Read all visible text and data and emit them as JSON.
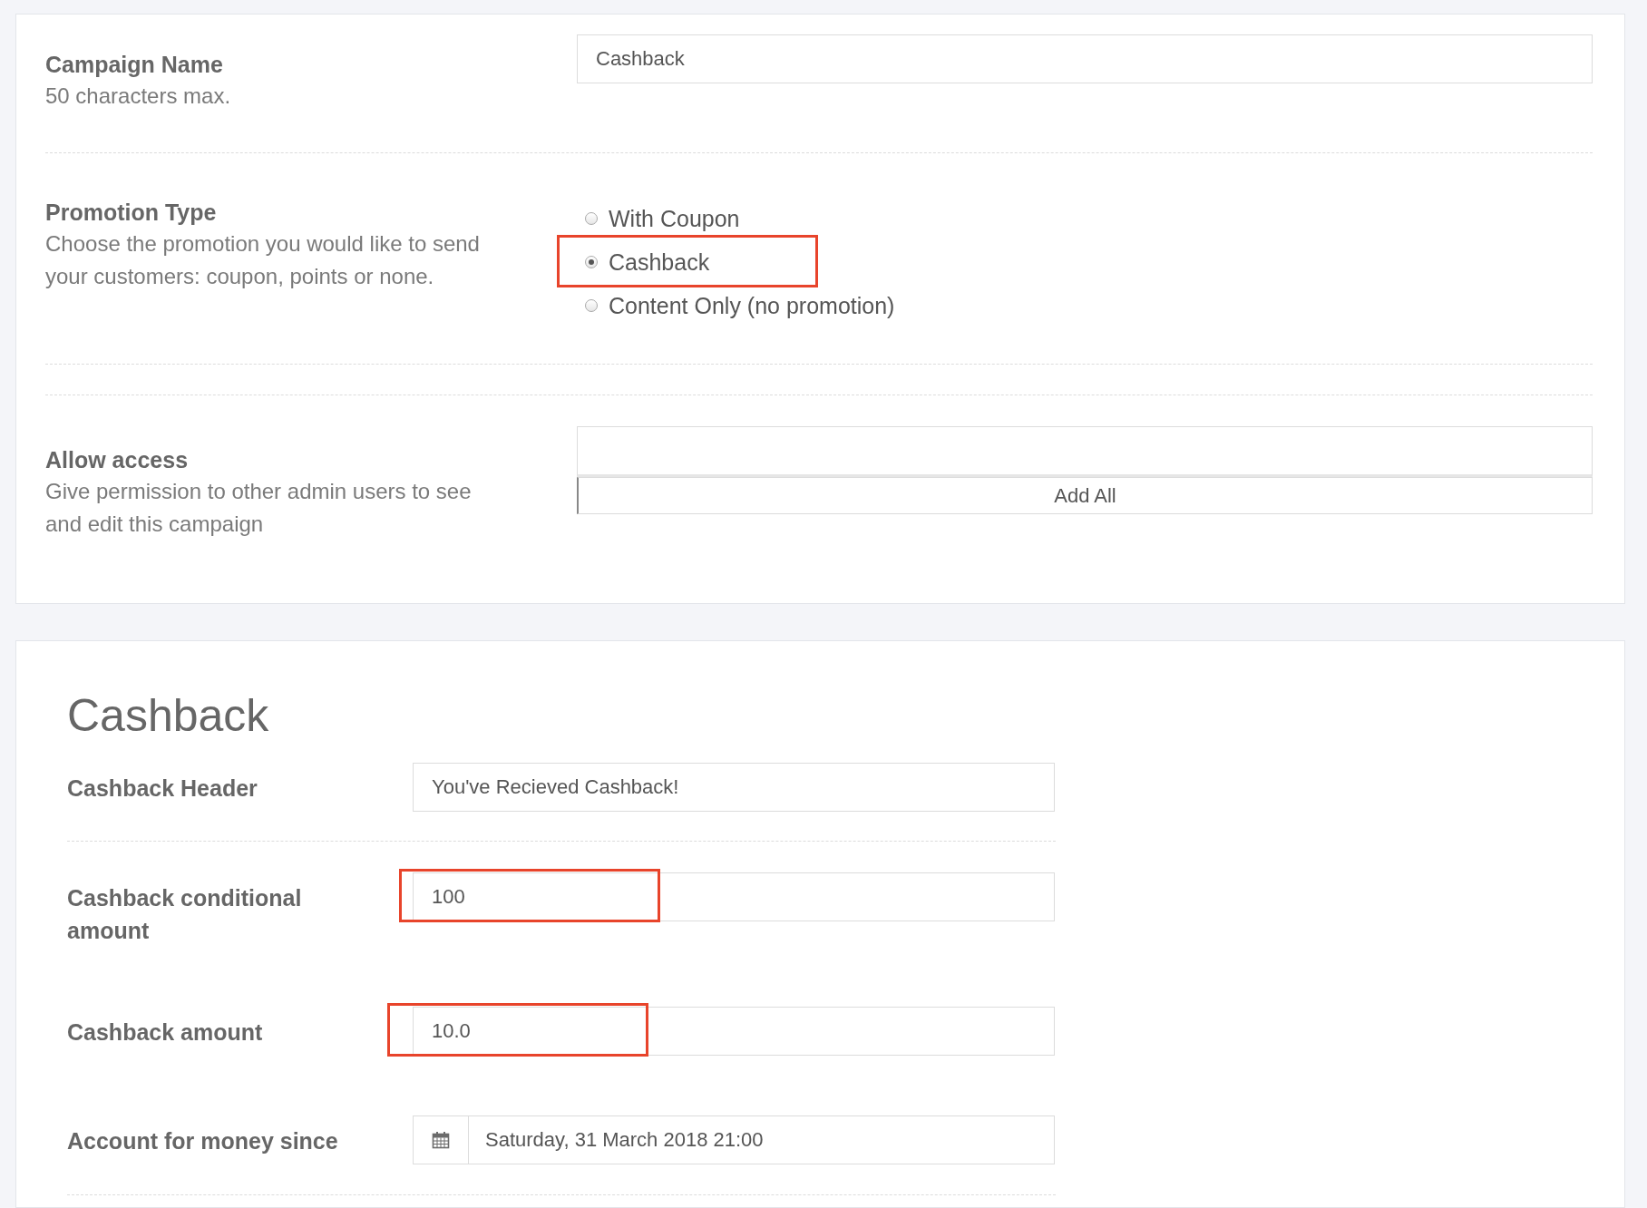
{
  "settings_panel": {
    "rows": [
      {
        "kind": "text",
        "label": "Campaign Name",
        "help": "50 characters max.",
        "value": "Cashback"
      },
      {
        "kind": "radio",
        "label": "Promotion Type",
        "help": "Choose the promotion you would like to send your customers: coupon, points or none.",
        "options": [
          {
            "label": "With Coupon",
            "selected": false,
            "highlighted": false
          },
          {
            "label": "Cashback",
            "selected": true,
            "highlighted": true
          },
          {
            "label": "Content Only (no promotion)",
            "selected": false,
            "highlighted": false
          }
        ]
      },
      {
        "kind": "access",
        "label": "Allow access",
        "help": "Give permission to other admin users to see and edit this campaign",
        "button": "Add All"
      }
    ]
  },
  "cashback_panel": {
    "title": "Cashback",
    "fields": [
      {
        "kind": "text",
        "label": "Cashback Header",
        "value": "You've Recieved Cashback!",
        "highlighted": false
      },
      {
        "kind": "text",
        "label": "Cashback conditional amount",
        "value": "100",
        "highlighted": true
      },
      {
        "kind": "text",
        "label": "Cashback amount",
        "value": "10.0",
        "highlighted": true
      },
      {
        "kind": "date",
        "label": "Account for money since",
        "value": "Saturday, 31 March 2018 21:00",
        "highlighted": false
      }
    ]
  }
}
